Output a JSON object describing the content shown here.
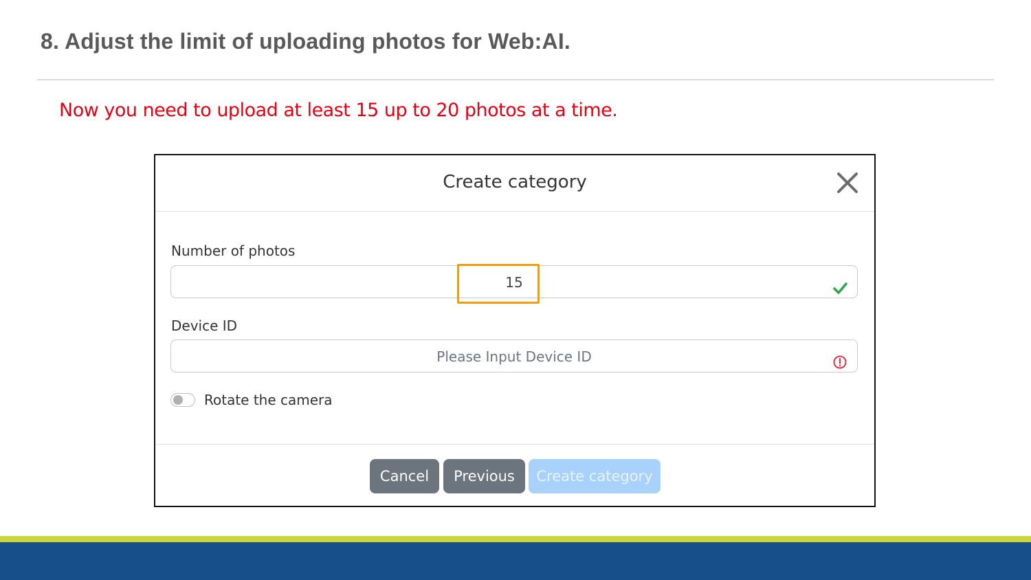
{
  "slide": {
    "title": "8. Adjust the limit of uploading photos for Web:AI.",
    "instruction": "Now you need to upload at least 15 up to 20 photos at a time."
  },
  "dialog": {
    "title": "Create category",
    "close_icon": "close-icon",
    "fields": {
      "photos": {
        "label": "Number of photos",
        "value": "15",
        "status_icon": "check-icon",
        "status_color": "#28a745"
      },
      "device": {
        "label": "Device ID",
        "placeholder": "Please Input Device ID",
        "status_icon": "error-circle-icon",
        "status_color": "#dc3545"
      }
    },
    "toggle": {
      "label": "Rotate the camera",
      "checked": false
    },
    "buttons": {
      "cancel": "Cancel",
      "previous": "Previous",
      "create": "Create category"
    }
  },
  "colors": {
    "instruction": "#e60012",
    "highlight": "#f29d0c",
    "band_accent": "#cbd63c",
    "band_main": "#164f8a"
  }
}
